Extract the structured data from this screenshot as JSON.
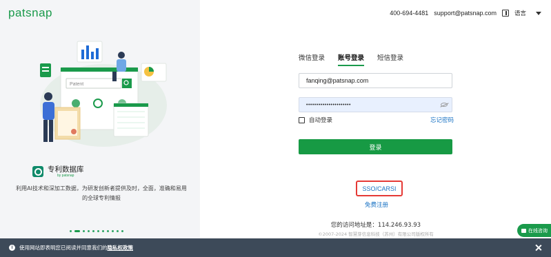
{
  "brand": {
    "logo": "patsnap"
  },
  "header": {
    "phone": "400-694-4481",
    "email": "support@patsnap.com",
    "language": "语言"
  },
  "promo": {
    "search_placeholder": "Patent",
    "product_title": "专利数据库",
    "product_by": "by patsnap",
    "description": "利用AI技术和深加工数据，为研发创新者提供及时，全面，准确和易用的全球专利情报",
    "carousel_dots": 11,
    "active_dot": 1
  },
  "login": {
    "tabs": [
      {
        "label": "微信登录",
        "active": false
      },
      {
        "label": "账号登录",
        "active": true
      },
      {
        "label": "短信登录",
        "active": false
      }
    ],
    "email_value": "fanqing@patsnap.com",
    "password_mask": "••••••••••••••••••••••",
    "remember_label": "自动登录",
    "forgot_label": "忘记密码",
    "submit_label": "登录",
    "sso_label": "SSO/CARSI",
    "register_label": "免费注册",
    "ip_text": "您的访问地址是：114.246.93.93",
    "copyright": "©2007-2024 智慧芽信息科技（苏州）有限公司版权所有"
  },
  "chat": {
    "label": "在线咨询"
  },
  "cookie_bar": {
    "text": "使用网站即表明您已阅读并同意我们的",
    "link": "隐私权政策"
  },
  "colors": {
    "brand_green": "#1a9a4b",
    "link_blue": "#1a73c4",
    "highlight_red": "#e53935"
  }
}
